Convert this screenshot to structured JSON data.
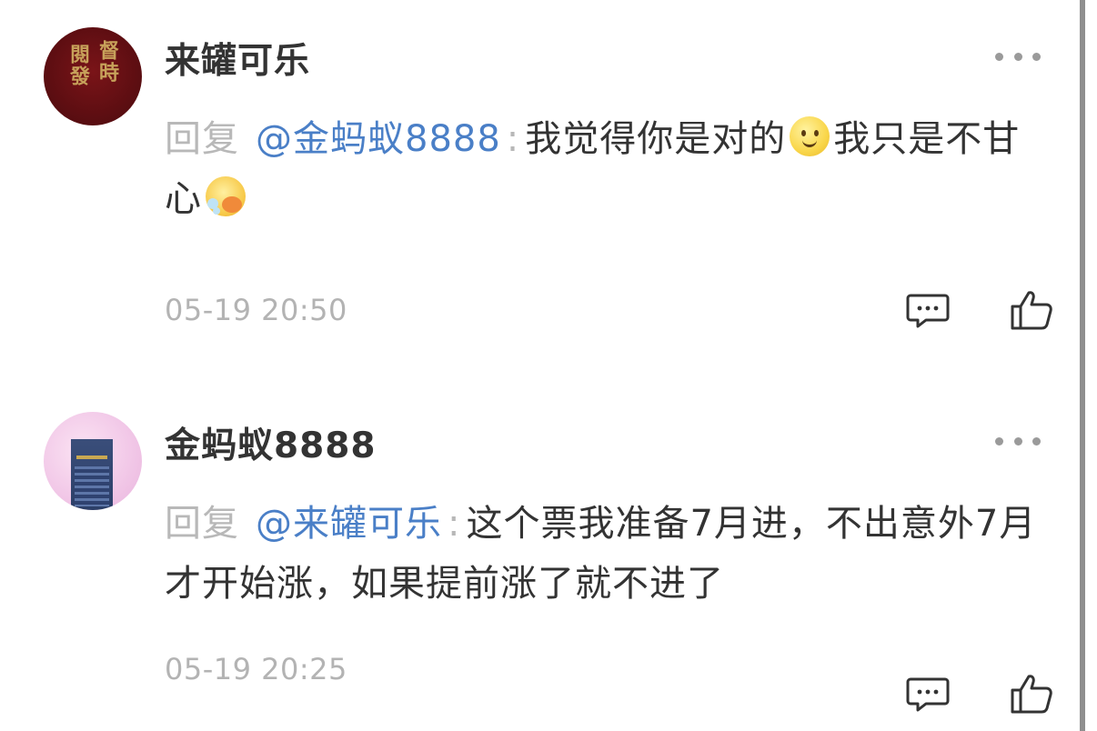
{
  "comments": [
    {
      "username": "来罐可乐",
      "avatar_text": "閱發 督時",
      "reply_label": "回复",
      "mention": "@金蚂蚁8888",
      "colon": ":",
      "text_a": "我觉得你是对的",
      "emoji_a": "smile-emoji",
      "text_b": "我只是不甘心",
      "emoji_b": "cough-emoji",
      "timestamp": "05-19 20:50"
    },
    {
      "username": "金蚂蚁8888",
      "reply_label": "回复",
      "mention": "@来罐可乐",
      "colon": ":",
      "text_a": "这个票我准备7月进，不出意外7月才开始涨，如果提前涨了就不进了",
      "timestamp": "05-19 20:25"
    }
  ],
  "colors": {
    "mention": "#4a7fc7",
    "reply_label": "#b8b8b8",
    "body": "#333333",
    "timestamp": "#b3b3b3"
  }
}
